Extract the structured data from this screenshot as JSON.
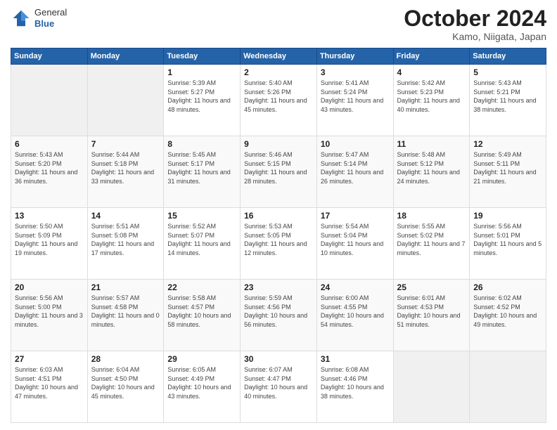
{
  "header": {
    "logo": {
      "general": "General",
      "blue": "Blue"
    },
    "title": "October 2024",
    "location": "Kamo, Niigata, Japan"
  },
  "days_of_week": [
    "Sunday",
    "Monday",
    "Tuesday",
    "Wednesday",
    "Thursday",
    "Friday",
    "Saturday"
  ],
  "weeks": [
    [
      {
        "day": "",
        "sunrise": "",
        "sunset": "",
        "daylight": "",
        "empty": true
      },
      {
        "day": "",
        "sunrise": "",
        "sunset": "",
        "daylight": "",
        "empty": true
      },
      {
        "day": "1",
        "sunrise": "Sunrise: 5:39 AM",
        "sunset": "Sunset: 5:27 PM",
        "daylight": "Daylight: 11 hours and 48 minutes."
      },
      {
        "day": "2",
        "sunrise": "Sunrise: 5:40 AM",
        "sunset": "Sunset: 5:26 PM",
        "daylight": "Daylight: 11 hours and 45 minutes."
      },
      {
        "day": "3",
        "sunrise": "Sunrise: 5:41 AM",
        "sunset": "Sunset: 5:24 PM",
        "daylight": "Daylight: 11 hours and 43 minutes."
      },
      {
        "day": "4",
        "sunrise": "Sunrise: 5:42 AM",
        "sunset": "Sunset: 5:23 PM",
        "daylight": "Daylight: 11 hours and 40 minutes."
      },
      {
        "day": "5",
        "sunrise": "Sunrise: 5:43 AM",
        "sunset": "Sunset: 5:21 PM",
        "daylight": "Daylight: 11 hours and 38 minutes."
      }
    ],
    [
      {
        "day": "6",
        "sunrise": "Sunrise: 5:43 AM",
        "sunset": "Sunset: 5:20 PM",
        "daylight": "Daylight: 11 hours and 36 minutes."
      },
      {
        "day": "7",
        "sunrise": "Sunrise: 5:44 AM",
        "sunset": "Sunset: 5:18 PM",
        "daylight": "Daylight: 11 hours and 33 minutes."
      },
      {
        "day": "8",
        "sunrise": "Sunrise: 5:45 AM",
        "sunset": "Sunset: 5:17 PM",
        "daylight": "Daylight: 11 hours and 31 minutes."
      },
      {
        "day": "9",
        "sunrise": "Sunrise: 5:46 AM",
        "sunset": "Sunset: 5:15 PM",
        "daylight": "Daylight: 11 hours and 28 minutes."
      },
      {
        "day": "10",
        "sunrise": "Sunrise: 5:47 AM",
        "sunset": "Sunset: 5:14 PM",
        "daylight": "Daylight: 11 hours and 26 minutes."
      },
      {
        "day": "11",
        "sunrise": "Sunrise: 5:48 AM",
        "sunset": "Sunset: 5:12 PM",
        "daylight": "Daylight: 11 hours and 24 minutes."
      },
      {
        "day": "12",
        "sunrise": "Sunrise: 5:49 AM",
        "sunset": "Sunset: 5:11 PM",
        "daylight": "Daylight: 11 hours and 21 minutes."
      }
    ],
    [
      {
        "day": "13",
        "sunrise": "Sunrise: 5:50 AM",
        "sunset": "Sunset: 5:09 PM",
        "daylight": "Daylight: 11 hours and 19 minutes."
      },
      {
        "day": "14",
        "sunrise": "Sunrise: 5:51 AM",
        "sunset": "Sunset: 5:08 PM",
        "daylight": "Daylight: 11 hours and 17 minutes."
      },
      {
        "day": "15",
        "sunrise": "Sunrise: 5:52 AM",
        "sunset": "Sunset: 5:07 PM",
        "daylight": "Daylight: 11 hours and 14 minutes."
      },
      {
        "day": "16",
        "sunrise": "Sunrise: 5:53 AM",
        "sunset": "Sunset: 5:05 PM",
        "daylight": "Daylight: 11 hours and 12 minutes."
      },
      {
        "day": "17",
        "sunrise": "Sunrise: 5:54 AM",
        "sunset": "Sunset: 5:04 PM",
        "daylight": "Daylight: 11 hours and 10 minutes."
      },
      {
        "day": "18",
        "sunrise": "Sunrise: 5:55 AM",
        "sunset": "Sunset: 5:02 PM",
        "daylight": "Daylight: 11 hours and 7 minutes."
      },
      {
        "day": "19",
        "sunrise": "Sunrise: 5:56 AM",
        "sunset": "Sunset: 5:01 PM",
        "daylight": "Daylight: 11 hours and 5 minutes."
      }
    ],
    [
      {
        "day": "20",
        "sunrise": "Sunrise: 5:56 AM",
        "sunset": "Sunset: 5:00 PM",
        "daylight": "Daylight: 11 hours and 3 minutes."
      },
      {
        "day": "21",
        "sunrise": "Sunrise: 5:57 AM",
        "sunset": "Sunset: 4:58 PM",
        "daylight": "Daylight: 11 hours and 0 minutes."
      },
      {
        "day": "22",
        "sunrise": "Sunrise: 5:58 AM",
        "sunset": "Sunset: 4:57 PM",
        "daylight": "Daylight: 10 hours and 58 minutes."
      },
      {
        "day": "23",
        "sunrise": "Sunrise: 5:59 AM",
        "sunset": "Sunset: 4:56 PM",
        "daylight": "Daylight: 10 hours and 56 minutes."
      },
      {
        "day": "24",
        "sunrise": "Sunrise: 6:00 AM",
        "sunset": "Sunset: 4:55 PM",
        "daylight": "Daylight: 10 hours and 54 minutes."
      },
      {
        "day": "25",
        "sunrise": "Sunrise: 6:01 AM",
        "sunset": "Sunset: 4:53 PM",
        "daylight": "Daylight: 10 hours and 51 minutes."
      },
      {
        "day": "26",
        "sunrise": "Sunrise: 6:02 AM",
        "sunset": "Sunset: 4:52 PM",
        "daylight": "Daylight: 10 hours and 49 minutes."
      }
    ],
    [
      {
        "day": "27",
        "sunrise": "Sunrise: 6:03 AM",
        "sunset": "Sunset: 4:51 PM",
        "daylight": "Daylight: 10 hours and 47 minutes."
      },
      {
        "day": "28",
        "sunrise": "Sunrise: 6:04 AM",
        "sunset": "Sunset: 4:50 PM",
        "daylight": "Daylight: 10 hours and 45 minutes."
      },
      {
        "day": "29",
        "sunrise": "Sunrise: 6:05 AM",
        "sunset": "Sunset: 4:49 PM",
        "daylight": "Daylight: 10 hours and 43 minutes."
      },
      {
        "day": "30",
        "sunrise": "Sunrise: 6:07 AM",
        "sunset": "Sunset: 4:47 PM",
        "daylight": "Daylight: 10 hours and 40 minutes."
      },
      {
        "day": "31",
        "sunrise": "Sunrise: 6:08 AM",
        "sunset": "Sunset: 4:46 PM",
        "daylight": "Daylight: 10 hours and 38 minutes."
      },
      {
        "day": "",
        "sunrise": "",
        "sunset": "",
        "daylight": "",
        "empty": true
      },
      {
        "day": "",
        "sunrise": "",
        "sunset": "",
        "daylight": "",
        "empty": true
      }
    ]
  ]
}
